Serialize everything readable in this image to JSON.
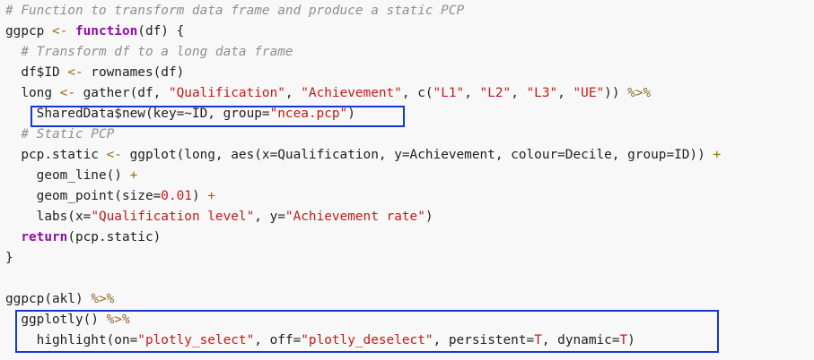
{
  "code": {
    "l1_comment": "# Function to transform data frame and produce a static PCP",
    "l2": {
      "a": "ggpcp ",
      "b": "<-",
      "c": " ",
      "d": "function",
      "e": "(df) {"
    },
    "l3_comment": "# Transform df to a long data frame",
    "l4": {
      "a": "df$ID ",
      "b": "<-",
      "c": " rownames(df)"
    },
    "l5": {
      "a": "long ",
      "b": "<-",
      "c": " gather(df, ",
      "d": "\"Qualification\"",
      "e": ", ",
      "f": "\"Achievement\"",
      "g": ", c(",
      "h": "\"L1\"",
      "i": ", ",
      "j": "\"L2\"",
      "k": ", ",
      "l": "\"L3\"",
      "m": ", ",
      "n": "\"UE\"",
      "o": ")) ",
      "p": "%>%"
    },
    "l6": {
      "a": "SharedData$new(key=~ID, group=",
      "b": "\"ncea.pcp\"",
      "c": ")"
    },
    "l7_comment": "# Static PCP",
    "l8": {
      "a": "pcp.static ",
      "b": "<-",
      "c": " ggplot(long, aes(x=Qualification, y=Achievement, colour=Decile, group=ID)) ",
      "d": "+"
    },
    "l9": {
      "a": "geom_line() ",
      "b": "+"
    },
    "l10": {
      "a": "geom_point(size=",
      "b": "0.01",
      "c": ") ",
      "d": "+"
    },
    "l11": {
      "a": "labs(x=",
      "b": "\"Qualification level\"",
      "c": ", y=",
      "d": "\"Achievement rate\"",
      "e": ")"
    },
    "l12": {
      "a": "return",
      "b": "(pcp.static)"
    },
    "l13": "}",
    "l15": {
      "a": "ggpcp(akl) ",
      "b": "%>%"
    },
    "l16": {
      "a": "ggplotly() ",
      "b": "%>%"
    },
    "l17": {
      "a": "highlight(on=",
      "b": "\"plotly_select\"",
      "c": ", off=",
      "d": "\"plotly_deselect\"",
      "e": ", persistent=",
      "f": "T",
      "g": ", dynamic=",
      "h": "T",
      "i": ")"
    }
  }
}
